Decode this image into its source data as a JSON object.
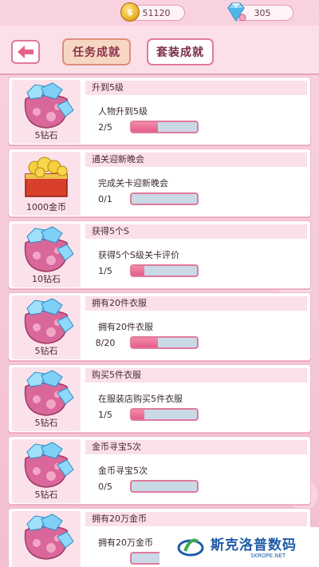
{
  "currency": {
    "gold_value": "51120",
    "gem_value": "305"
  },
  "tabs": [
    {
      "label": "任务成就",
      "active": true
    },
    {
      "label": "套装成就",
      "active": false
    }
  ],
  "achievements": [
    {
      "reward_icon": "gem-bag-icon",
      "reward": "5钻石",
      "title": "升到5级",
      "desc": "人物升到5级",
      "progress": "2/5",
      "fraction": 0.4
    },
    {
      "reward_icon": "gold-chest-icon",
      "reward": "1000金币",
      "title": "通关迎新晚会",
      "desc": "完成关卡迎新晚会",
      "progress": "0/1",
      "fraction": 0
    },
    {
      "reward_icon": "gem-bag-icon",
      "reward": "10钻石",
      "title": "获得5个S",
      "desc": "获得5个S级关卡评价",
      "progress": "1/5",
      "fraction": 0.2
    },
    {
      "reward_icon": "gem-bag-icon",
      "reward": "5钻石",
      "title": "拥有20件衣服",
      "desc": "拥有20件衣服",
      "progress": "8/20",
      "fraction": 0.4
    },
    {
      "reward_icon": "gem-bag-icon",
      "reward": "5钻石",
      "title": "购买5件衣服",
      "desc": "在服装店购买5件衣服",
      "progress": "1/5",
      "fraction": 0.2
    },
    {
      "reward_icon": "gem-bag-icon",
      "reward": "5钻石",
      "title": "金币寻宝5次",
      "desc": "金币寻宝5次",
      "progress": "0/5",
      "fraction": 0
    },
    {
      "reward_icon": "gem-bag-icon",
      "reward": "",
      "title": "拥有20万金币",
      "desc": "拥有20万金币",
      "progress": "",
      "fraction": 0
    }
  ],
  "watermark": {
    "text": "斯克洛普数码",
    "sub": "SKROPE.NET"
  },
  "colors": {
    "accent": "#e07a9c",
    "bar_fill": "#e35f87",
    "bar_empty": "#c9d9e6",
    "brand_blue": "#1f5ba8"
  }
}
